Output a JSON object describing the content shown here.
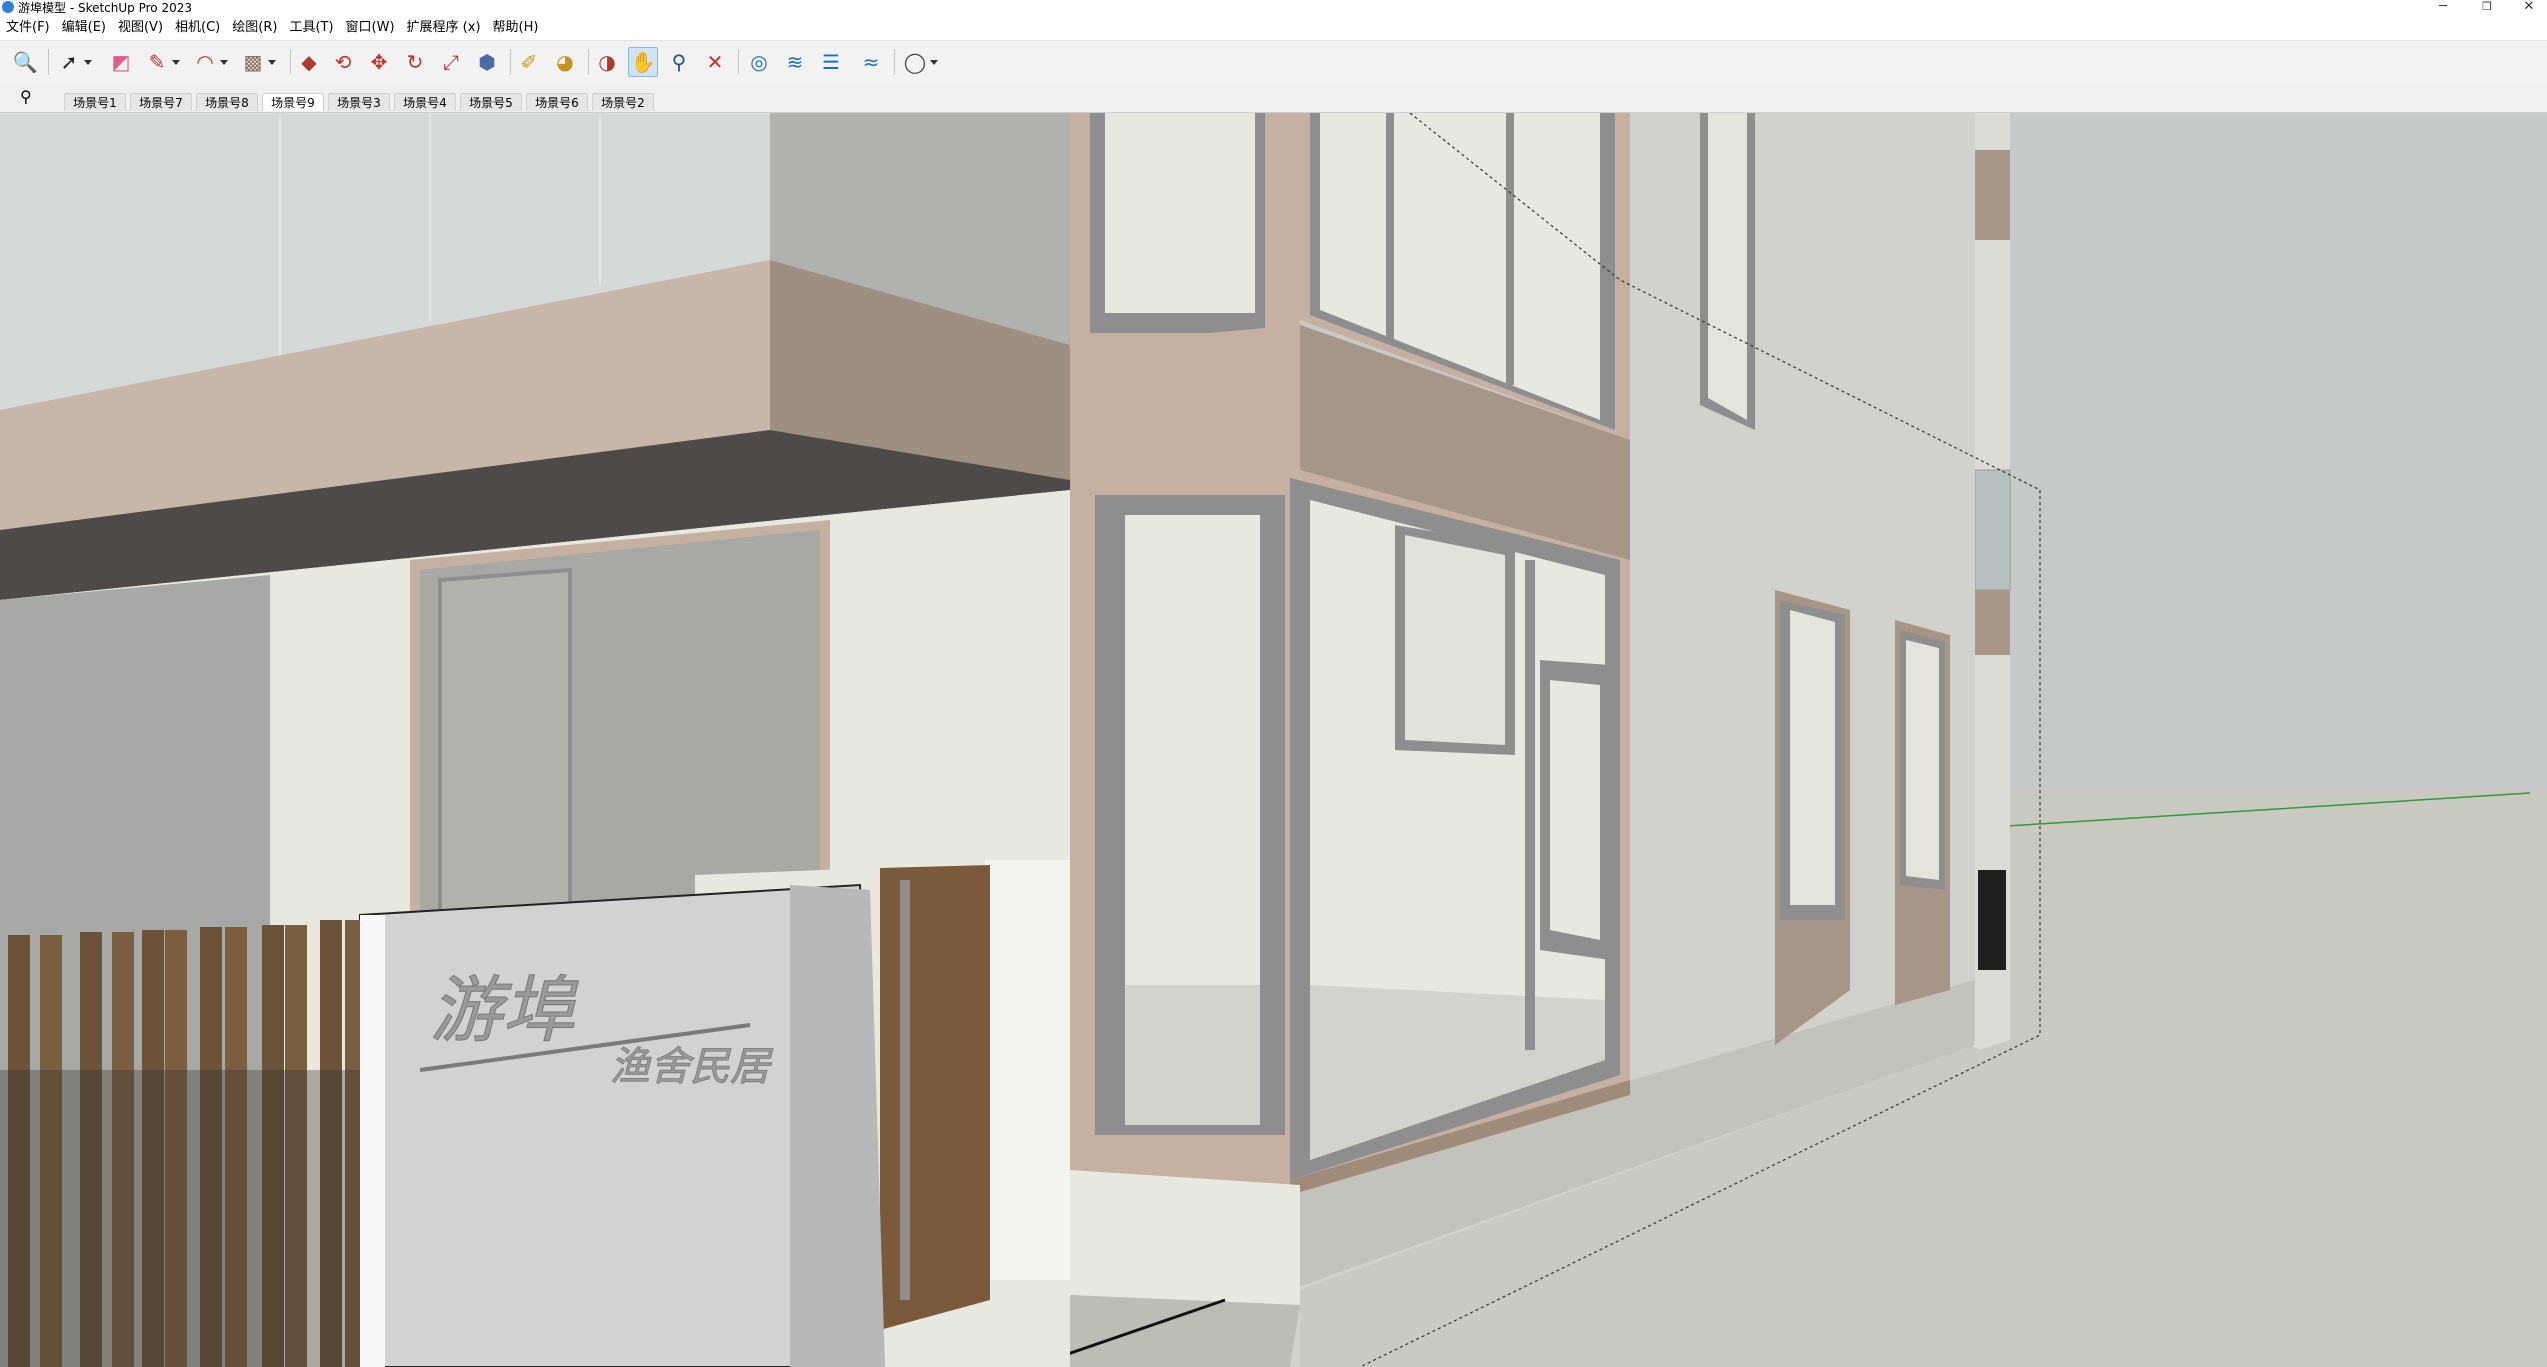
{
  "window": {
    "title": "游埠模型 - SketchUp Pro 2023",
    "minimize_glyph": "─",
    "maximize_glyph": "❐",
    "close_glyph": "✕"
  },
  "menu": [
    {
      "label": "文件(F)"
    },
    {
      "label": "编辑(E)"
    },
    {
      "label": "视图(V)"
    },
    {
      "label": "相机(C)"
    },
    {
      "label": "绘图(R)"
    },
    {
      "label": "工具(T)"
    },
    {
      "label": "窗口(W)"
    },
    {
      "label": "扩展程序 (x)"
    },
    {
      "label": "帮助(H)"
    }
  ],
  "toolbar": {
    "tools": [
      {
        "name": "zoom-window-icon",
        "glyph": "🔍"
      },
      {
        "name": "select-icon",
        "glyph": "➚"
      },
      {
        "name": "eraser-icon",
        "glyph": "◩"
      },
      {
        "name": "pencil-icon",
        "glyph": "✎"
      },
      {
        "name": "arc-icon",
        "glyph": "◠"
      },
      {
        "name": "rectangle-icon",
        "glyph": "▩"
      },
      {
        "name": "push-pull-icon",
        "glyph": "◆"
      },
      {
        "name": "offset-icon",
        "glyph": "⟲"
      },
      {
        "name": "move-icon",
        "glyph": "✥"
      },
      {
        "name": "rotate-icon",
        "glyph": "↻"
      },
      {
        "name": "scale-icon",
        "glyph": "⤢"
      },
      {
        "name": "follow-me-icon",
        "glyph": "⬢"
      },
      {
        "name": "tape-measure-icon",
        "glyph": "✐"
      },
      {
        "name": "paint-bucket-icon",
        "glyph": "◕"
      },
      {
        "name": "orbit-icon",
        "glyph": "◑"
      },
      {
        "name": "pan-icon",
        "glyph": "✋"
      },
      {
        "name": "zoom-icon",
        "glyph": "⚲"
      },
      {
        "name": "zoom-extents-icon",
        "glyph": "✕"
      },
      {
        "name": "warehouse-icon",
        "glyph": "◎"
      },
      {
        "name": "extension-icon",
        "glyph": "≋"
      },
      {
        "name": "layers-icon",
        "glyph": "☰"
      },
      {
        "name": "section-icon",
        "glyph": "≈"
      },
      {
        "name": "account-icon",
        "glyph": "◯"
      }
    ]
  },
  "scenes": {
    "search_glyph": "⚲",
    "tabs": [
      {
        "label": "场景号1"
      },
      {
        "label": "场景号7"
      },
      {
        "label": "场景号8"
      },
      {
        "label": "场景号9"
      },
      {
        "label": "场景号3"
      },
      {
        "label": "场景号4"
      },
      {
        "label": "场景号5"
      },
      {
        "label": "场景号6"
      },
      {
        "label": "场景号2"
      }
    ],
    "active": "场景号9"
  },
  "model": {
    "sign_main_text": "游埠",
    "sign_sub_text": "渔舍民居"
  },
  "colors": {
    "sky": "#c8ccca",
    "ground": "#cacac4",
    "wall": "#e8e8e0",
    "trim": "#c5b0a1",
    "frame": "#8e8e8e",
    "wood": "#6b5238",
    "axis_green": "#2e9c3a"
  }
}
